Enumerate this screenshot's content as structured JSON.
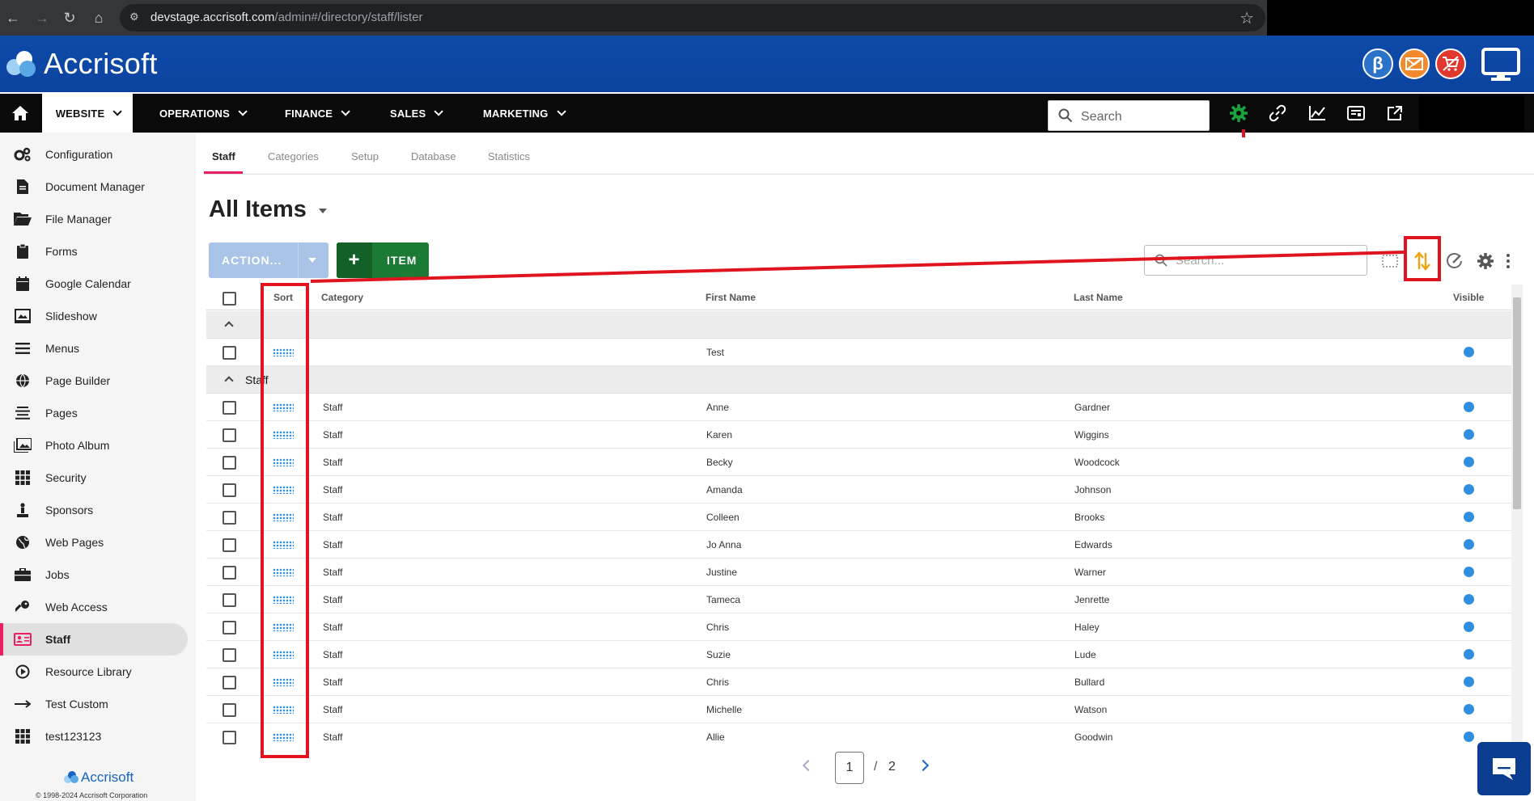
{
  "browser": {
    "url_host": "devstage.accrisoft.com",
    "url_path": "/admin#/directory/staff/lister"
  },
  "app": {
    "logo_text": "Accrisoft",
    "beta_label": "β"
  },
  "nav": {
    "items": [
      "WEBSITE",
      "OPERATIONS",
      "FINANCE",
      "SALES",
      "MARKETING"
    ],
    "search_placeholder": "Search"
  },
  "sidebar": {
    "items": [
      {
        "label": "Configuration",
        "icon": "gears-icon"
      },
      {
        "label": "Document Manager",
        "icon": "document-icon"
      },
      {
        "label": "File Manager",
        "icon": "folder-open-icon"
      },
      {
        "label": "Forms",
        "icon": "clipboard-icon"
      },
      {
        "label": "Google Calendar",
        "icon": "calendar-icon"
      },
      {
        "label": "Slideshow",
        "icon": "slideshow-icon"
      },
      {
        "label": "Menus",
        "icon": "menu-bars-icon"
      },
      {
        "label": "Page Builder",
        "icon": "globe-icon"
      },
      {
        "label": "Pages",
        "icon": "align-lines-icon"
      },
      {
        "label": "Photo Album",
        "icon": "photo-icon"
      },
      {
        "label": "Security",
        "icon": "grid-icon"
      },
      {
        "label": "Sponsors",
        "icon": "sponsor-icon"
      },
      {
        "label": "Web Pages",
        "icon": "globe-icon"
      },
      {
        "label": "Jobs",
        "icon": "briefcase-icon"
      },
      {
        "label": "Web Access",
        "icon": "key-icon"
      },
      {
        "label": "Staff",
        "icon": "id-card-icon"
      },
      {
        "label": "Resource Library",
        "icon": "play-circle-icon"
      },
      {
        "label": "Test Custom",
        "icon": "arrow-right-icon"
      },
      {
        "label": "test123123",
        "icon": "grid-icon"
      }
    ],
    "footer_logo": "Accrisoft",
    "copyright": "© 1998-2024 Accrisoft Corporation"
  },
  "tabs": [
    "Staff",
    "Categories",
    "Setup",
    "Database",
    "Statistics"
  ],
  "page": {
    "title": "All Items",
    "action_label": "ACTION...",
    "item_label": "ITEM",
    "search_placeholder": "Search..."
  },
  "table": {
    "headers": {
      "sort": "Sort",
      "category": "Category",
      "first": "First Name",
      "last": "Last Name",
      "visible": "Visible"
    },
    "group_blank_label": "",
    "group_staff_label": "Staff",
    "ungrouped_rows": [
      {
        "category": "",
        "first": "Test",
        "last": ""
      }
    ],
    "staff_rows": [
      {
        "category": "Staff",
        "first": "Anne",
        "last": "Gardner"
      },
      {
        "category": "Staff",
        "first": "Karen",
        "last": "Wiggins"
      },
      {
        "category": "Staff",
        "first": "Becky",
        "last": "Woodcock"
      },
      {
        "category": "Staff",
        "first": "Amanda",
        "last": "Johnson"
      },
      {
        "category": "Staff",
        "first": "Colleen",
        "last": "Brooks"
      },
      {
        "category": "Staff",
        "first": "Jo Anna",
        "last": "Edwards"
      },
      {
        "category": "Staff",
        "first": "Justine",
        "last": "Warner"
      },
      {
        "category": "Staff",
        "first": "Tameca",
        "last": "Jenrette"
      },
      {
        "category": "Staff",
        "first": "Chris",
        "last": "Haley"
      },
      {
        "category": "Staff",
        "first": "Suzie",
        "last": "Lude"
      },
      {
        "category": "Staff",
        "first": "Chris",
        "last": "Bullard"
      },
      {
        "category": "Staff",
        "first": "Michelle",
        "last": "Watson"
      },
      {
        "category": "Staff",
        "first": "Allie",
        "last": "Goodwin"
      }
    ]
  },
  "pager": {
    "current": "1",
    "separator": "/",
    "total": "2"
  },
  "colors": {
    "header_blue": "#0c43a0",
    "accent_pink": "#e91e63",
    "annotation_red": "#e0141e",
    "item_green": "#1b7a33",
    "visible_dot": "#2f8ee0"
  }
}
